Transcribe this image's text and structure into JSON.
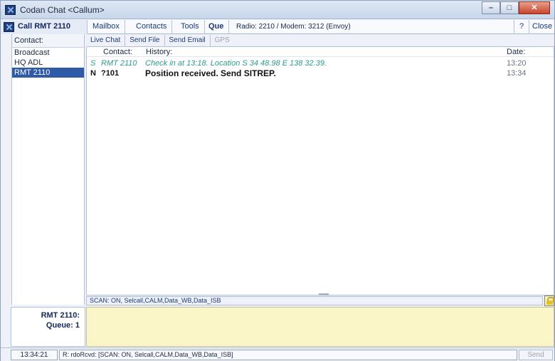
{
  "window": {
    "title": "Codan Chat <Callum>"
  },
  "toolbar": {
    "call_label": "Call RMT 2110",
    "mailbox_label": "Mailbox",
    "contacts_label": "Contacts",
    "tools_label": "Tools",
    "que_label": "Que",
    "radio_status": "Radio: 2210 / Modem: 3212 (Envoy)",
    "help_label": "?",
    "close_label": "Close"
  },
  "contacts": {
    "header": "Contact:",
    "items": [
      {
        "label": "Broadcast",
        "selected": false
      },
      {
        "label": "HQ ADL",
        "selected": false
      },
      {
        "label": "RMT 2110",
        "selected": true
      }
    ]
  },
  "tabs": [
    {
      "label": "Live Chat",
      "enabled": true
    },
    {
      "label": "Send File",
      "enabled": true
    },
    {
      "label": "Send Email",
      "enabled": true
    },
    {
      "label": "GPS",
      "enabled": false
    }
  ],
  "history": {
    "col_contact": "Contact:",
    "col_history": "History:",
    "col_date": "Date:",
    "messages": [
      {
        "flag": "S",
        "contact": "RMT 2110",
        "text": "Check in at 13:18. Location S 34 48.98 E 138 32.39.",
        "date": "13:20"
      },
      {
        "flag": "N",
        "contact": "?101",
        "text": "Position received. Send SITREP.",
        "date": "13:34"
      }
    ]
  },
  "scan_status": "SCAN: ON, Selcall,CALM,Data_WB,Data_ISB",
  "queue": {
    "name": "RMT 2110:",
    "count": "Queue: 1"
  },
  "compose": {
    "value": ""
  },
  "bottom": {
    "clock": "13:34:21",
    "status": "R: rdoRcvd: [SCAN: ON, Selcall,CALM,Data_WB,Data_ISB]",
    "send_label": "Send"
  },
  "colors": {
    "accent": "#2f5aa8",
    "compose_bg": "#fbf6c8",
    "sent_text": "#2e9a8e"
  }
}
